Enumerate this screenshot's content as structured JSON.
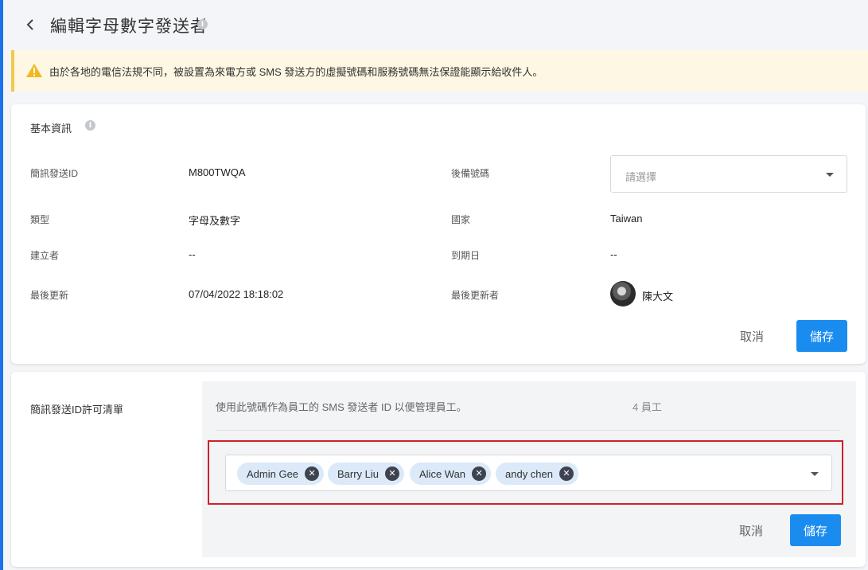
{
  "header": {
    "title": "編輯字母數字發送者"
  },
  "warning": {
    "text": "由於各地的電信法規不同，被設置為來電方或 SMS 發送方的虛擬號碼和服務號碼無法保證能顯示給收件人。"
  },
  "basic_info": {
    "title": "基本資訊",
    "sender_id_label": "簡訊發送ID",
    "sender_id_value": "M800TWQA",
    "backup_label": "後備號碼",
    "backup_placeholder": "請選擇",
    "type_label": "類型",
    "type_value": "字母及數字",
    "country_label": "國家",
    "country_value": "Taiwan",
    "creator_label": "建立者",
    "creator_value": "--",
    "expiry_label": "到期日",
    "expiry_value": "--",
    "updated_label": "最後更新",
    "updated_value": "07/04/2022 18:18:02",
    "updater_label": "最後更新者",
    "updater_value": "陳大文",
    "cancel_label": "取消",
    "save_label": "儲存"
  },
  "allowlist": {
    "title": "簡訊發送ID許可清單",
    "description": "使用此號碼作為員工的 SMS 發送者 ID 以便管理員工。",
    "count": "4 員工",
    "tags": [
      "Admin Gee",
      "Barry Liu",
      "Alice Wan",
      "andy chen"
    ],
    "cancel_label": "取消",
    "save_label": "儲存"
  },
  "colors": {
    "primary": "#1a8cf0",
    "warning_bg": "#fdf7e3",
    "highlight": "#d0202a"
  },
  "icons": [
    "chevron-left-icon",
    "info-icon",
    "warning-icon",
    "dropdown-caret-icon",
    "remove-tag-icon"
  ]
}
